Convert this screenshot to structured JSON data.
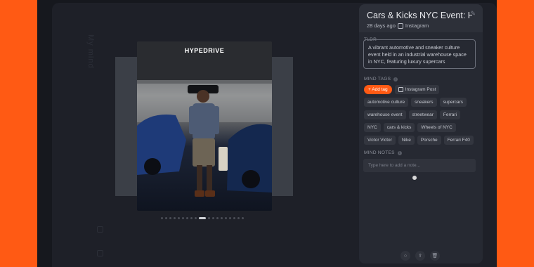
{
  "sidebar": {
    "text": "My mind",
    "bottom_icons": [
      "settings-icon",
      "grid-icon"
    ]
  },
  "viewer": {
    "brand_label": "HYPEDRIVE",
    "carousel_count": 19,
    "carousel_active_index": 9
  },
  "panel": {
    "title": "Cars & Kicks NYC Event: Hi...",
    "meta_time": "28 days ago",
    "meta_source": "Instagram",
    "tldr_label": "TLDR",
    "tldr_text": "A vibrant automotive and sneaker culture event held in an industrial warehouse space in NYC, featuring luxury supercars",
    "mind_tags_label": "MIND TAGS",
    "add_tag_label": "+ Add tag",
    "source_tag": "Instagram Post",
    "tags": [
      "automotive culture",
      "sneakers",
      "supercars",
      "warehouse event",
      "streetwear",
      "Ferrari",
      "NYC",
      "cars & kicks",
      "Wheels of NYC",
      "Victor Victor",
      "Nike",
      "Porsche",
      "Ferrari F40"
    ],
    "mind_notes_label": "MIND NOTES",
    "note_placeholder": "Type here to add a note..."
  },
  "colors": {
    "accent": "#ff5a14",
    "panel": "#262932",
    "background": "#1e2028"
  }
}
